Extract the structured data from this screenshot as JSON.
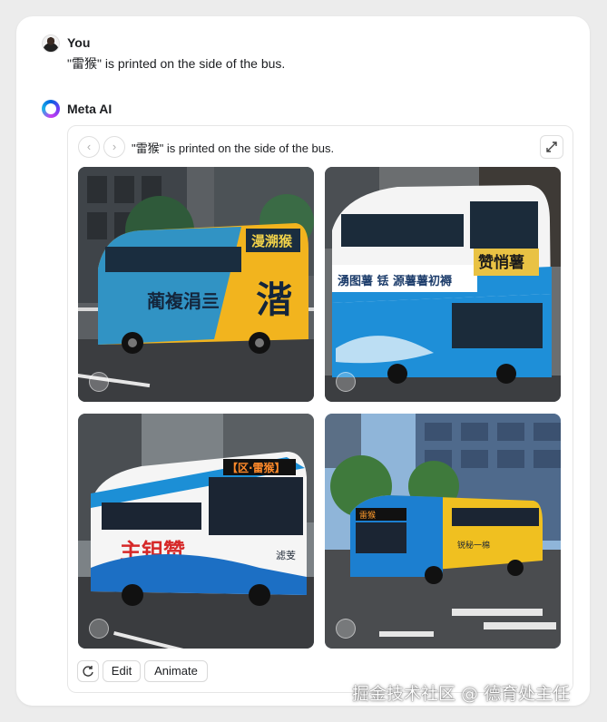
{
  "user": {
    "name": "You",
    "message": "\"雷猴\" is printed on the side of the bus."
  },
  "assistant": {
    "name": "Meta AI"
  },
  "panel": {
    "prev_icon": "chevron-left-icon",
    "next_icon": "chevron-right-icon",
    "caption": "\"雷猴\" is printed on the side of the bus.",
    "expand_icon": "expand-icon"
  },
  "images": {
    "img1": {
      "front_text": "漫溯猴",
      "side_text": "蔺複涓亖",
      "big_glyph": "湝"
    },
    "img2": {
      "front_text": "赞悄薯",
      "side_text": "湧图薯 铥 源薯薯初褥"
    },
    "img3": {
      "front_text": "【区·雷猴】",
      "side_text": "主钽赞",
      "small_text": "滤芰"
    },
    "img4": {
      "front_text": "雷猴",
      "side_text": "锐秘一棉"
    }
  },
  "actions": {
    "regenerate_icon": "refresh-icon",
    "edit_label": "Edit",
    "animate_label": "Animate"
  },
  "watermark": "掘金技术社区 @ 德育处主任"
}
